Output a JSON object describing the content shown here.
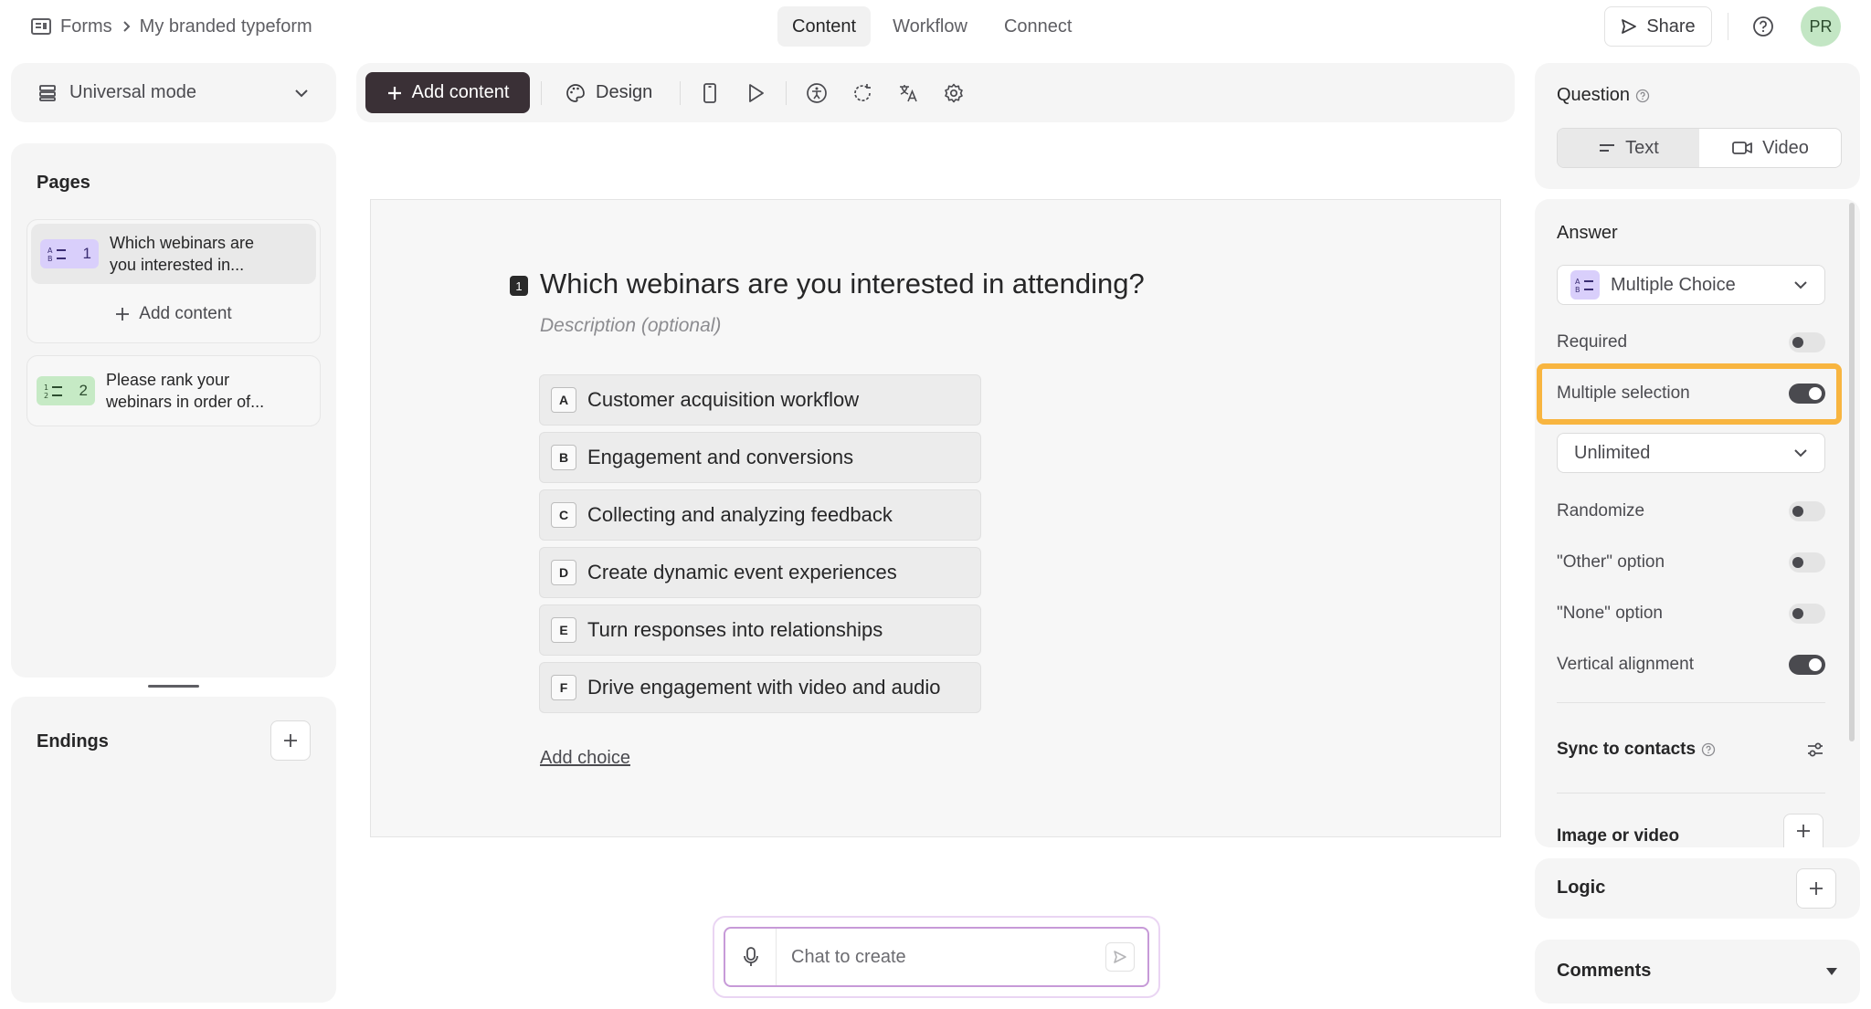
{
  "breadcrumb": {
    "root": "Forms",
    "current": "My branded typeform"
  },
  "top_tabs": [
    {
      "label": "Content",
      "active": true
    },
    {
      "label": "Workflow",
      "active": false
    },
    {
      "label": "Connect",
      "active": false
    }
  ],
  "share_label": "Share",
  "avatar_initials": "PR",
  "mode_select": {
    "label": "Universal mode"
  },
  "pages": {
    "title": "Pages",
    "items": [
      {
        "badge": "1",
        "text": "Which webinars are you interested in...",
        "badge_color": "#d9cffb"
      },
      {
        "badge": "2",
        "text": "Please rank your webinars in order of...",
        "badge_color": "#c6eac5"
      }
    ],
    "add_content": "Add content"
  },
  "endings": {
    "title": "Endings"
  },
  "toolbar": {
    "add_content": "Add content",
    "design": "Design",
    "icons": [
      "mobile-preview-icon",
      "play-icon",
      "accessibility-icon",
      "refresh-icon",
      "translate-icon",
      "settings-icon"
    ]
  },
  "question": {
    "number": "1",
    "title": "Which webinars are you interested in attending?",
    "description": "Description (optional)",
    "choices": [
      {
        "key": "A",
        "label": "Customer acquisition workflow"
      },
      {
        "key": "B",
        "label": "Engagement and conversions"
      },
      {
        "key": "C",
        "label": "Collecting and analyzing feedback"
      },
      {
        "key": "D",
        "label": "Create dynamic event experiences"
      },
      {
        "key": "E",
        "label": "Turn responses into relationships"
      },
      {
        "key": "F",
        "label": "Drive engagement with video and audio"
      }
    ],
    "add_choice": "Add choice"
  },
  "chat": {
    "placeholder": "Chat to create"
  },
  "right_panel": {
    "question_title": "Question",
    "question_type": {
      "text": "Text",
      "video": "Video",
      "active": "Text"
    },
    "answer_title": "Answer",
    "answer_type": "Multiple Choice",
    "settings": [
      {
        "label": "Required",
        "on": false
      },
      {
        "label": "Multiple selection",
        "on": true,
        "highlighted": true
      },
      {
        "label": "Randomize",
        "on": false
      },
      {
        "label": "\"Other\" option",
        "on": false
      },
      {
        "label": "\"None\" option",
        "on": false
      },
      {
        "label": "Vertical alignment",
        "on": true
      }
    ],
    "selection_limit": "Unlimited",
    "sync_contacts": "Sync to contacts",
    "image_or_video": "Image or video",
    "logic": "Logic",
    "comments": "Comments"
  },
  "colors": {
    "accent_dark": "#3a3036",
    "highlight": "#f8b540",
    "chat_border": "#c79ad8"
  }
}
